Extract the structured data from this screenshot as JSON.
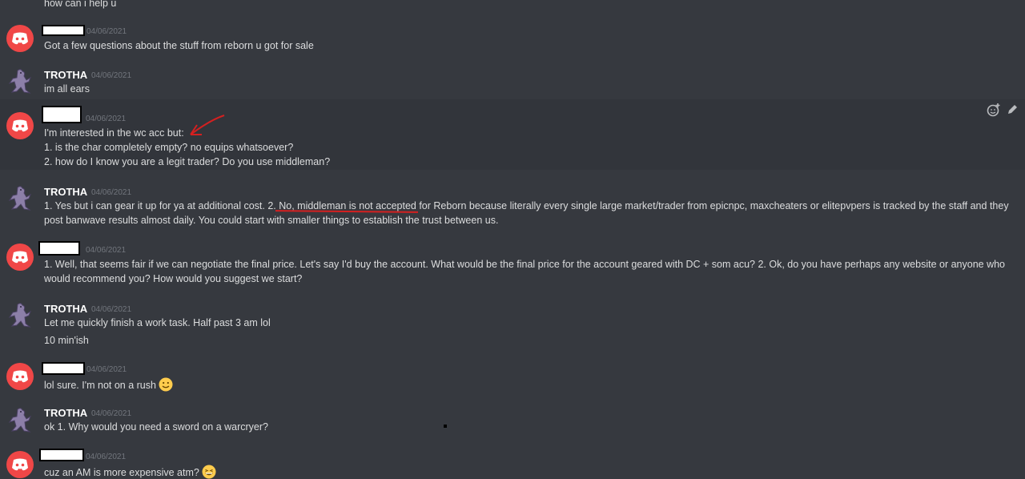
{
  "messages": [
    {
      "text": "how can i help u"
    },
    {
      "author": "",
      "timestamp": "04/06/2021",
      "lines": [
        "Got a few questions about the stuff from reborn u got for sale"
      ]
    },
    {
      "author": "TROTHA",
      "timestamp": "04/06/2021",
      "lines": [
        "im all ears"
      ]
    },
    {
      "author": "",
      "timestamp": "04/06/2021",
      "lines": [
        "I'm interested in the wc acc but:",
        "1.  is the char completely empty? no equips whatsoever?",
        "2. how do I know you are a legit trader? Do you use middleman?"
      ]
    },
    {
      "author": "TROTHA",
      "timestamp": "04/06/2021",
      "lines": [
        "1. Yes but i can gear it up for ya at additional cost. 2. No, middleman is not accepted for Reborn because literally every single large market/trader from epicnpc, maxcheaters or elitepvpers is tracked by the staff and they post banwave results almost daily. You could start with smaller things to establish the trust between us."
      ]
    },
    {
      "author": "",
      "timestamp": "04/06/2021",
      "lines": [
        "1. Well, that seems fair if we can negotiate the final price. Let's say I'd buy the account. What would be the final price for the account geared with DC + som acu? 2. Ok, do you have perhaps any website or anyone who would recommend you? How would you suggest we start?"
      ]
    },
    {
      "author": "TROTHA",
      "timestamp": "04/06/2021",
      "lines": [
        "Let me quickly finish a work task. Half past 3 am lol",
        "10 min'ish"
      ]
    },
    {
      "author": "",
      "timestamp": "04/06/2021",
      "lines": [
        "lol sure. I'm not on a rush"
      ]
    },
    {
      "author": "TROTHA",
      "timestamp": "04/06/2021",
      "lines": [
        "ok 1. Why would you need a sword on a warcryer?"
      ]
    },
    {
      "author": "",
      "timestamp": "04/06/2021",
      "lines": [
        "cuz an AM is more expensive atm?"
      ]
    }
  ],
  "icons": {
    "discord_avatar": "discord-logo-icon",
    "mewtwo_avatar": "mewtwo-avatar-icon",
    "add_reaction": "add-reaction-icon",
    "edit": "edit-pencil-icon",
    "smile_emoji": "slightly-smiling-face-emoji",
    "grin_emoji": "grinning-squinting-face-emoji"
  },
  "colors": {
    "background": "#36393f",
    "username": "#ffffff",
    "timestamp": "#72767d",
    "discord_red": "#f04747",
    "annotation_red": "#d42020"
  }
}
